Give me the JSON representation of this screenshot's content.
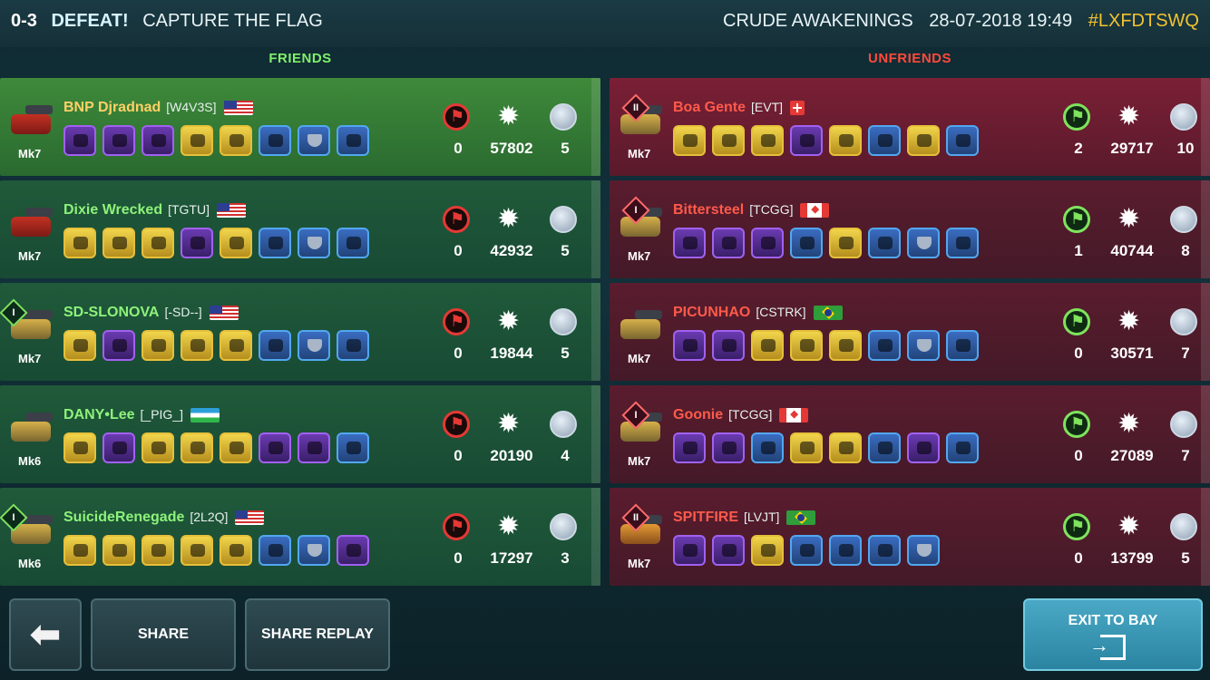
{
  "header": {
    "score": "0-3",
    "result": "DEFEAT!",
    "mode": "CAPTURE THE FLAG",
    "map": "CRUDE AWAKENINGS",
    "datetime": "28-07-2018 19:49",
    "match_code": "#LXFDTSWQ"
  },
  "teams": {
    "friends_label": "FRIENDS",
    "unfriends_label": "UNFRIENDS"
  },
  "friends": [
    {
      "name": "BNP Djradnad",
      "tag": "[W4V3S]",
      "flag": "us",
      "mk": "Mk7",
      "rank": "",
      "flags": "0",
      "damage": "57802",
      "coins": "5",
      "items": [
        "purple",
        "purple",
        "purple",
        "gold",
        "gold",
        "blue",
        "blue",
        "blue"
      ]
    },
    {
      "name": "Dixie Wrecked",
      "tag": "[TGTU]",
      "flag": "us",
      "mk": "Mk7",
      "rank": "",
      "flags": "0",
      "damage": "42932",
      "coins": "5",
      "items": [
        "gold",
        "gold",
        "gold",
        "purple",
        "gold",
        "blue",
        "blue",
        "blue"
      ]
    },
    {
      "name": "SD-SLONOVA",
      "tag": "[-SD--]",
      "flag": "us",
      "mk": "Mk7",
      "rank": "I",
      "flags": "0",
      "damage": "19844",
      "coins": "5",
      "items": [
        "gold",
        "purple",
        "gold",
        "gold",
        "gold",
        "blue",
        "blue",
        "blue"
      ]
    },
    {
      "name": "DANY•Lee",
      "tag": "[_PIG_]",
      "flag": "uz",
      "mk": "Mk6",
      "rank": "",
      "flags": "0",
      "damage": "20190",
      "coins": "4",
      "items": [
        "gold",
        "purple",
        "gold",
        "gold",
        "gold",
        "purple",
        "purple",
        "blue"
      ]
    },
    {
      "name": "SuicideRenegade",
      "tag": "[2L2Q]",
      "flag": "us",
      "mk": "Mk6",
      "rank": "I",
      "flags": "0",
      "damage": "17297",
      "coins": "3",
      "items": [
        "gold",
        "gold",
        "gold",
        "gold",
        "gold",
        "blue",
        "blue",
        "purple"
      ]
    }
  ],
  "unfriends": [
    {
      "name": "Boa Gente",
      "tag": "[EVT]",
      "flag": "ch",
      "mk": "Mk7",
      "rank": "II",
      "flags": "2",
      "damage": "29717",
      "coins": "10",
      "items": [
        "gold",
        "gold",
        "gold",
        "purple",
        "gold",
        "blue",
        "gold",
        "blue"
      ]
    },
    {
      "name": "Bittersteel",
      "tag": "[TCGG]",
      "flag": "ca",
      "mk": "Mk7",
      "rank": "I",
      "flags": "1",
      "damage": "40744",
      "coins": "8",
      "items": [
        "purple",
        "purple",
        "purple",
        "blue",
        "gold",
        "blue",
        "blue",
        "blue"
      ]
    },
    {
      "name": "PICUNHAO",
      "tag": "[CSTRK]",
      "flag": "br",
      "mk": "Mk7",
      "rank": "",
      "flags": "0",
      "damage": "30571",
      "coins": "7",
      "items": [
        "purple",
        "purple",
        "gold",
        "gold",
        "gold",
        "blue",
        "blue",
        "blue"
      ]
    },
    {
      "name": "Goonie",
      "tag": "[TCGG]",
      "flag": "ca",
      "mk": "Mk7",
      "rank": "I",
      "flags": "0",
      "damage": "27089",
      "coins": "7",
      "items": [
        "purple",
        "purple",
        "blue",
        "gold",
        "gold",
        "blue",
        "purple",
        "blue"
      ]
    },
    {
      "name": "SPITFIRE",
      "tag": "[LVJT]",
      "flag": "br",
      "mk": "Mk7",
      "rank": "II",
      "flags": "0",
      "damage": "13799",
      "coins": "5",
      "items": [
        "purple",
        "purple",
        "gold",
        "blue",
        "blue",
        "blue",
        "blue"
      ]
    }
  ],
  "buttons": {
    "share": "SHARE",
    "share_replay": "SHARE REPLAY",
    "exit": "EXIT TO BAY"
  }
}
